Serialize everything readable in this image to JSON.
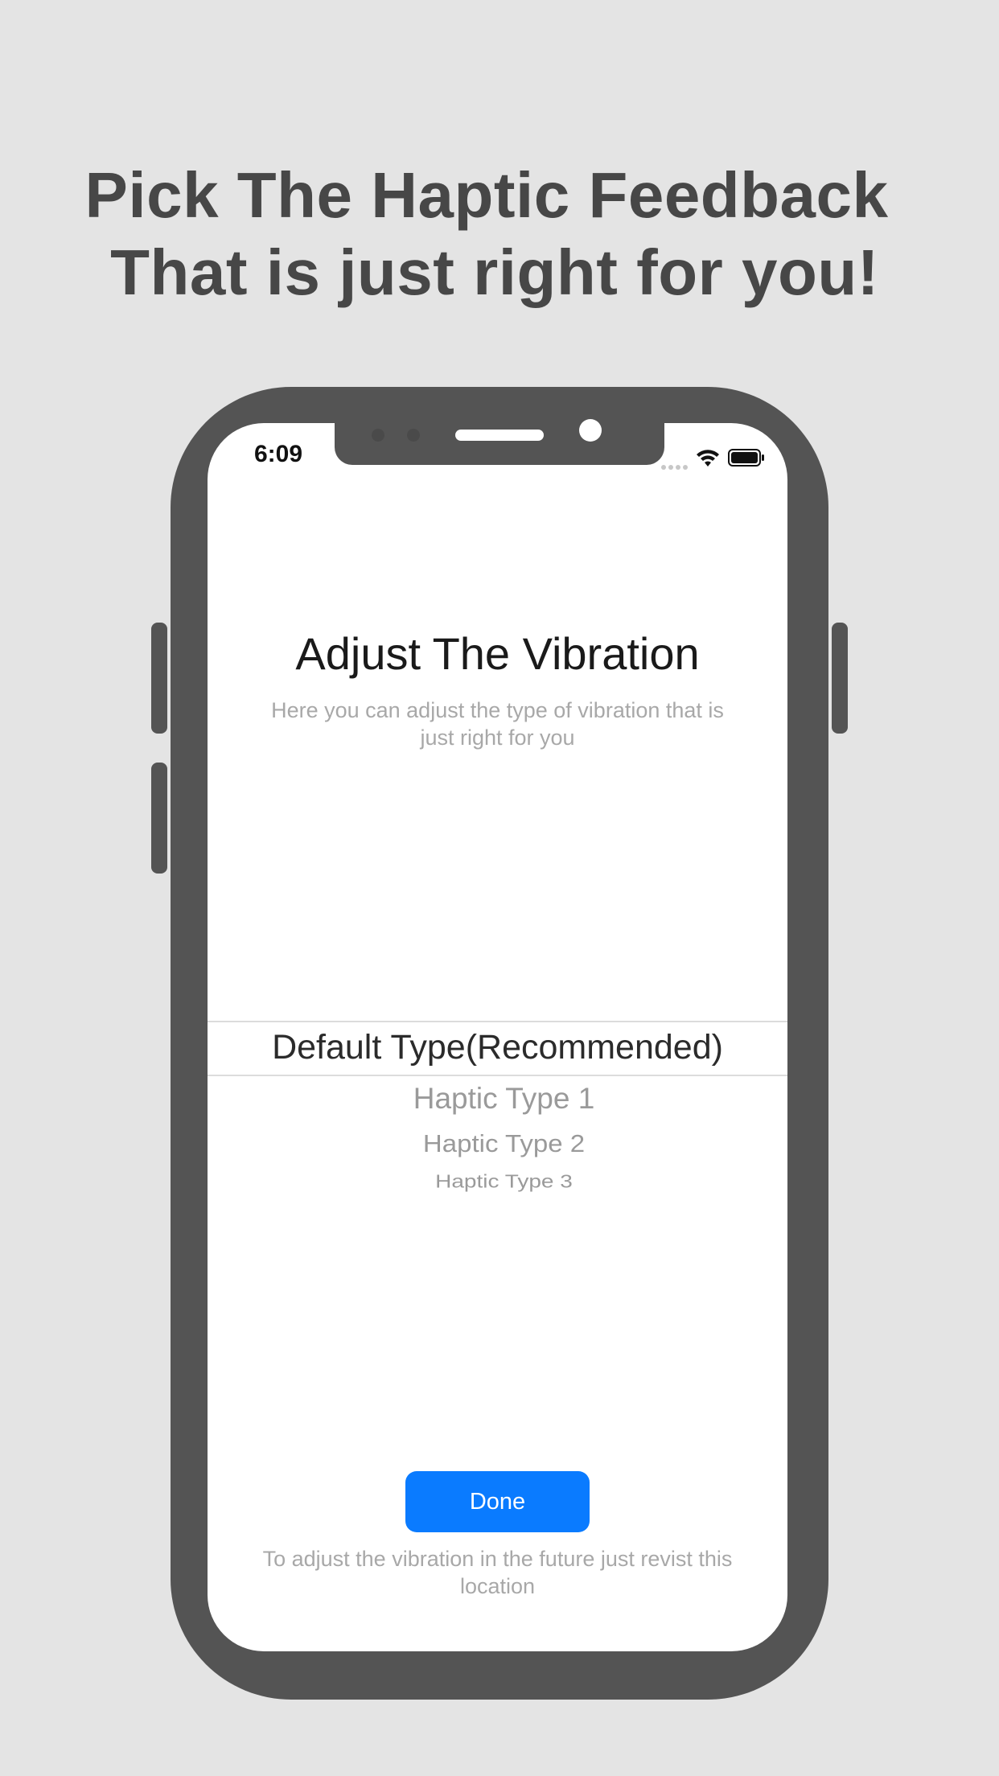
{
  "promo": {
    "line1": "Pick The Haptic Feedback",
    "line2": "That is just right for you!"
  },
  "status_bar": {
    "time": "6:09",
    "icons": [
      "signal-icon",
      "wifi-icon",
      "battery-icon"
    ]
  },
  "screen": {
    "title": "Adjust The Vibration",
    "subtitle": "Here you can adjust the type of vibration that is just right for you",
    "picker": {
      "selected": "Default Type(Recommended)",
      "options": [
        "Haptic Type 1",
        "Haptic Type 2",
        "Haptic Type 3"
      ]
    },
    "done_label": "Done",
    "footer": "To adjust the vibration in the future just revist this location"
  },
  "colors": {
    "background": "#e4e4e4",
    "phone_body": "#545454",
    "accent": "#0a7bff",
    "headline": "#474747"
  }
}
